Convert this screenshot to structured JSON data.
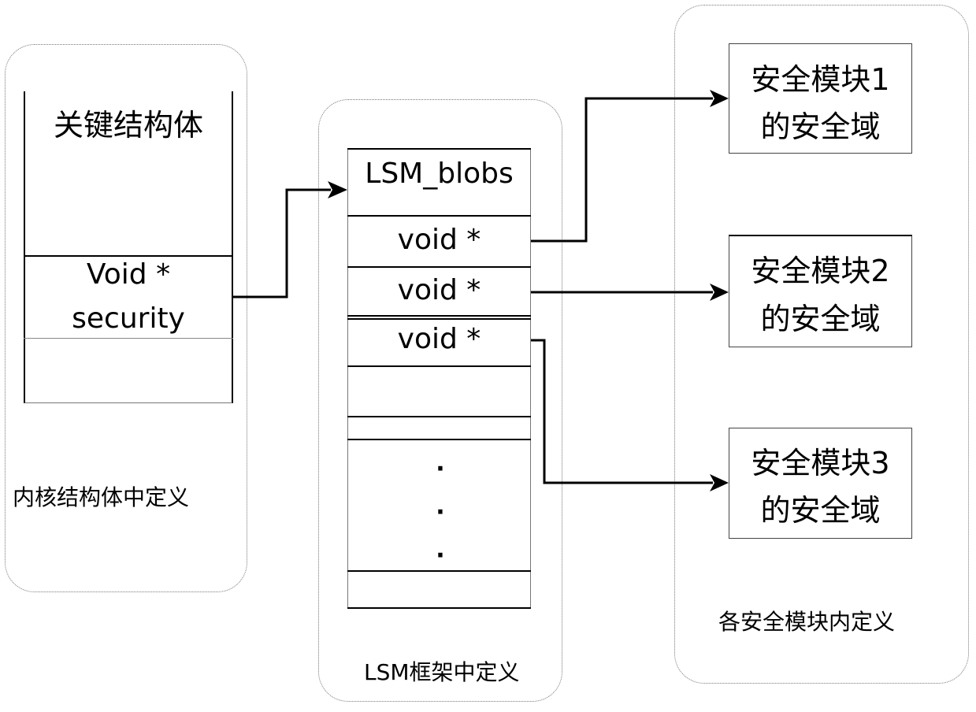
{
  "kernel_group": {
    "caption": "内核结构体中定义",
    "struct_title": "关键结构体",
    "field_line1": "Void *",
    "field_line2": "security"
  },
  "lsm_group": {
    "caption": "LSM框架中定义",
    "header": "LSM_blobs",
    "slots": [
      "void *",
      "void *",
      "void *"
    ],
    "ellipsis": [
      "·",
      "·",
      "·"
    ]
  },
  "module_group": {
    "caption": "各安全模块内定义",
    "domains": [
      {
        "line1": "安全模块1",
        "line2": "的安全域"
      },
      {
        "line1": "安全模块2",
        "line2": "的安全域"
      },
      {
        "line1": "安全模块3",
        "line2": "的安全域"
      }
    ]
  }
}
